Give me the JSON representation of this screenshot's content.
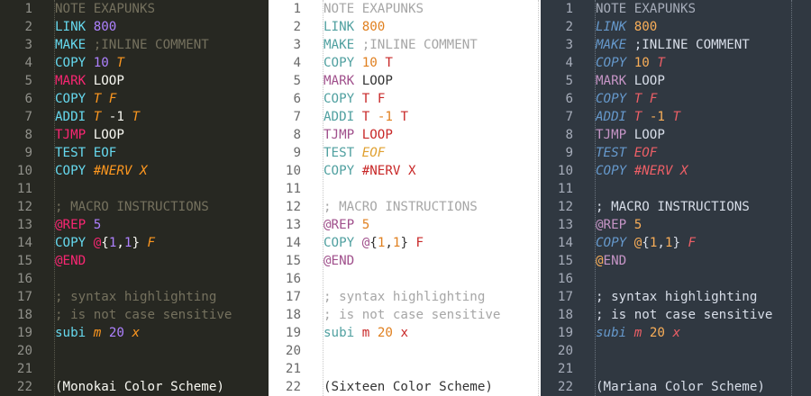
{
  "themes": [
    {
      "id": "monokai",
      "colors": {
        "bg": "#272822",
        "ln": "#90908a",
        "guide": "#5a5a4e",
        "comment": "#75715e",
        "plain": "#f8f8f2",
        "keyword": "#f92672",
        "op": "#66d9ef",
        "number": "#ae81ff",
        "param": "#fd971f",
        "builtin": "#66d9ef"
      },
      "lines": [
        [
          {
            "t": "NOTE EXAPUNKS",
            "c": "comment"
          }
        ],
        [
          {
            "t": "LINK",
            "c": "op"
          },
          {
            "t": " "
          },
          {
            "t": "800",
            "c": "number"
          }
        ],
        [
          {
            "t": "MAKE",
            "c": "op"
          },
          {
            "t": " ;INLINE COMMENT",
            "c": "comment"
          }
        ],
        [
          {
            "t": "COPY",
            "c": "op"
          },
          {
            "t": " "
          },
          {
            "t": "10",
            "c": "number"
          },
          {
            "t": " "
          },
          {
            "t": "T",
            "c": "param",
            "i": true
          }
        ],
        [
          {
            "t": "MARK",
            "c": "keyword"
          },
          {
            "t": " LOOP",
            "c": "plain"
          }
        ],
        [
          {
            "t": "COPY",
            "c": "op"
          },
          {
            "t": " "
          },
          {
            "t": "T",
            "c": "param",
            "i": true
          },
          {
            "t": " "
          },
          {
            "t": "F",
            "c": "param",
            "i": true
          }
        ],
        [
          {
            "t": "ADDI",
            "c": "op"
          },
          {
            "t": " "
          },
          {
            "t": "T",
            "c": "param",
            "i": true
          },
          {
            "t": " -1",
            "c": "plain"
          },
          {
            "t": " "
          },
          {
            "t": "T",
            "c": "param",
            "i": true
          }
        ],
        [
          {
            "t": "TJMP",
            "c": "keyword"
          },
          {
            "t": " LOOP",
            "c": "plain"
          }
        ],
        [
          {
            "t": "TEST",
            "c": "op"
          },
          {
            "t": " EOF",
            "c": "op"
          }
        ],
        [
          {
            "t": "COPY",
            "c": "op"
          },
          {
            "t": " "
          },
          {
            "t": "#NERV",
            "c": "param",
            "i": true
          },
          {
            "t": " "
          },
          {
            "t": "X",
            "c": "param",
            "i": true
          }
        ],
        [],
        [
          {
            "t": "; MACRO INSTRUCTIONS",
            "c": "comment"
          }
        ],
        [
          {
            "t": "@",
            "c": "keyword"
          },
          {
            "t": "REP",
            "c": "keyword"
          },
          {
            "t": " "
          },
          {
            "t": "5",
            "c": "number"
          }
        ],
        [
          {
            "t": "COPY",
            "c": "op"
          },
          {
            "t": " "
          },
          {
            "t": "@",
            "c": "keyword"
          },
          {
            "t": "{",
            "c": "plain"
          },
          {
            "t": "1",
            "c": "number"
          },
          {
            "t": ",",
            "c": "plain"
          },
          {
            "t": "1",
            "c": "number"
          },
          {
            "t": "}",
            "c": "plain"
          },
          {
            "t": " "
          },
          {
            "t": "F",
            "c": "param",
            "i": true
          }
        ],
        [
          {
            "t": "@END",
            "c": "keyword"
          }
        ],
        [],
        [
          {
            "t": "; syntax highlighting",
            "c": "comment"
          }
        ],
        [
          {
            "t": "; is not case sensitive",
            "c": "comment"
          }
        ],
        [
          {
            "t": "subi",
            "c": "op"
          },
          {
            "t": " "
          },
          {
            "t": "m",
            "c": "param",
            "i": true
          },
          {
            "t": " "
          },
          {
            "t": "20",
            "c": "number"
          },
          {
            "t": " "
          },
          {
            "t": "x",
            "c": "param",
            "i": true
          }
        ],
        [],
        [],
        [
          {
            "t": "(Monokai Color Scheme)",
            "c": "plain"
          }
        ]
      ]
    },
    {
      "id": "sixteen",
      "colors": {
        "bg": "#ffffff",
        "ln": "#6a6a6a",
        "guide": "#c8c8c8",
        "comment": "#a6a6a6",
        "plain": "#333333",
        "keyword": "#a0508c",
        "op": "#50a0a0",
        "number": "#e08020",
        "param": "#c82828",
        "builtin": "#e0a030"
      },
      "lines": [
        [
          {
            "t": "NOTE EXAPUNKS",
            "c": "comment"
          }
        ],
        [
          {
            "t": "LINK",
            "c": "op"
          },
          {
            "t": " "
          },
          {
            "t": "800",
            "c": "number"
          }
        ],
        [
          {
            "t": "MAKE",
            "c": "op"
          },
          {
            "t": " ;INLINE COMMENT",
            "c": "comment"
          }
        ],
        [
          {
            "t": "COPY",
            "c": "op"
          },
          {
            "t": " "
          },
          {
            "t": "10",
            "c": "number"
          },
          {
            "t": " "
          },
          {
            "t": "T",
            "c": "param"
          }
        ],
        [
          {
            "t": "MARK",
            "c": "keyword"
          },
          {
            "t": " LOOP",
            "c": "plain"
          }
        ],
        [
          {
            "t": "COPY",
            "c": "op"
          },
          {
            "t": " "
          },
          {
            "t": "T",
            "c": "param"
          },
          {
            "t": " "
          },
          {
            "t": "F",
            "c": "param"
          }
        ],
        [
          {
            "t": "ADDI",
            "c": "op"
          },
          {
            "t": " "
          },
          {
            "t": "T",
            "c": "param"
          },
          {
            "t": " "
          },
          {
            "t": "-1",
            "c": "number"
          },
          {
            "t": " "
          },
          {
            "t": "T",
            "c": "param"
          }
        ],
        [
          {
            "t": "TJMP",
            "c": "keyword"
          },
          {
            "t": " LOOP",
            "c": "param"
          }
        ],
        [
          {
            "t": "TEST",
            "c": "op"
          },
          {
            "t": " "
          },
          {
            "t": "EOF",
            "c": "builtin",
            "i": true
          }
        ],
        [
          {
            "t": "COPY",
            "c": "op"
          },
          {
            "t": " "
          },
          {
            "t": "#NERV",
            "c": "param"
          },
          {
            "t": " "
          },
          {
            "t": "X",
            "c": "param"
          }
        ],
        [],
        [
          {
            "t": "; MACRO INSTRUCTIONS",
            "c": "comment"
          }
        ],
        [
          {
            "t": "@",
            "c": "keyword"
          },
          {
            "t": "REP",
            "c": "keyword"
          },
          {
            "t": " "
          },
          {
            "t": "5",
            "c": "number"
          }
        ],
        [
          {
            "t": "COPY",
            "c": "op"
          },
          {
            "t": " "
          },
          {
            "t": "@",
            "c": "keyword"
          },
          {
            "t": "{",
            "c": "plain"
          },
          {
            "t": "1",
            "c": "number"
          },
          {
            "t": ",",
            "c": "plain"
          },
          {
            "t": "1",
            "c": "number"
          },
          {
            "t": "}",
            "c": "plain"
          },
          {
            "t": " "
          },
          {
            "t": "F",
            "c": "param"
          }
        ],
        [
          {
            "t": "@END",
            "c": "keyword"
          }
        ],
        [],
        [
          {
            "t": "; syntax highlighting",
            "c": "comment"
          }
        ],
        [
          {
            "t": "; is not case sensitive",
            "c": "comment"
          }
        ],
        [
          {
            "t": "subi",
            "c": "op"
          },
          {
            "t": " "
          },
          {
            "t": "m",
            "c": "param"
          },
          {
            "t": " "
          },
          {
            "t": "20",
            "c": "number"
          },
          {
            "t": " "
          },
          {
            "t": "x",
            "c": "param"
          }
        ],
        [],
        [],
        [
          {
            "t": "(Sixteen Color Scheme)",
            "c": "plain"
          }
        ]
      ]
    },
    {
      "id": "mariana",
      "colors": {
        "bg": "#303841",
        "ln": "#a6acb9",
        "guide": "#6a737d",
        "comment": "#a6acb9",
        "plain": "#d8dee9",
        "keyword": "#c695c6",
        "op": "#6699cc",
        "number": "#f9ae58",
        "param": "#ec5f66",
        "builtin": "#c695c6"
      },
      "lines": [
        [
          {
            "t": "NOTE EXAPUNKS",
            "c": "comment"
          }
        ],
        [
          {
            "t": "LINK",
            "c": "op",
            "i": true
          },
          {
            "t": " "
          },
          {
            "t": "800",
            "c": "number"
          }
        ],
        [
          {
            "t": "MAKE",
            "c": "op",
            "i": true
          },
          {
            "t": " ;INLINE COMMENT",
            "c": "plain"
          }
        ],
        [
          {
            "t": "COPY",
            "c": "op",
            "i": true
          },
          {
            "t": " "
          },
          {
            "t": "10",
            "c": "number"
          },
          {
            "t": " "
          },
          {
            "t": "T",
            "c": "param",
            "i": true
          }
        ],
        [
          {
            "t": "MARK",
            "c": "keyword"
          },
          {
            "t": " LOOP",
            "c": "plain"
          }
        ],
        [
          {
            "t": "COPY",
            "c": "op",
            "i": true
          },
          {
            "t": " "
          },
          {
            "t": "T",
            "c": "param",
            "i": true
          },
          {
            "t": " "
          },
          {
            "t": "F",
            "c": "param",
            "i": true
          }
        ],
        [
          {
            "t": "ADDI",
            "c": "op",
            "i": true
          },
          {
            "t": " "
          },
          {
            "t": "T",
            "c": "param",
            "i": true
          },
          {
            "t": " "
          },
          {
            "t": "-1",
            "c": "number"
          },
          {
            "t": " "
          },
          {
            "t": "T",
            "c": "param",
            "i": true
          }
        ],
        [
          {
            "t": "TJMP",
            "c": "keyword"
          },
          {
            "t": " LOOP",
            "c": "plain"
          }
        ],
        [
          {
            "t": "TEST",
            "c": "op",
            "i": true
          },
          {
            "t": " "
          },
          {
            "t": "EOF",
            "c": "param",
            "i": true
          }
        ],
        [
          {
            "t": "COPY",
            "c": "op",
            "i": true
          },
          {
            "t": " "
          },
          {
            "t": "#NERV",
            "c": "param",
            "i": true
          },
          {
            "t": " "
          },
          {
            "t": "X",
            "c": "param",
            "i": true
          }
        ],
        [],
        [
          {
            "t": "; MACRO INSTRUCTIONS",
            "c": "plain"
          }
        ],
        [
          {
            "t": "@",
            "c": "keyword"
          },
          {
            "t": "REP",
            "c": "keyword"
          },
          {
            "t": " "
          },
          {
            "t": "5",
            "c": "number"
          }
        ],
        [
          {
            "t": "COPY",
            "c": "op",
            "i": true
          },
          {
            "t": " "
          },
          {
            "t": "@",
            "c": "number"
          },
          {
            "t": "{",
            "c": "plain"
          },
          {
            "t": "1",
            "c": "number"
          },
          {
            "t": ",",
            "c": "plain"
          },
          {
            "t": "1",
            "c": "number"
          },
          {
            "t": "}",
            "c": "plain"
          },
          {
            "t": " "
          },
          {
            "t": "F",
            "c": "param",
            "i": true
          }
        ],
        [
          {
            "t": "@",
            "c": "number"
          },
          {
            "t": "END",
            "c": "keyword"
          }
        ],
        [],
        [
          {
            "t": "; syntax highlighting",
            "c": "plain"
          }
        ],
        [
          {
            "t": "; is not case sensitive",
            "c": "plain"
          }
        ],
        [
          {
            "t": "subi",
            "c": "op",
            "i": true
          },
          {
            "t": " "
          },
          {
            "t": "m",
            "c": "param",
            "i": true
          },
          {
            "t": " "
          },
          {
            "t": "20",
            "c": "number"
          },
          {
            "t": " "
          },
          {
            "t": "x",
            "c": "param",
            "i": true
          }
        ],
        [],
        [],
        [
          {
            "t": "(Mariana Color Scheme)",
            "c": "plain"
          }
        ]
      ]
    }
  ]
}
